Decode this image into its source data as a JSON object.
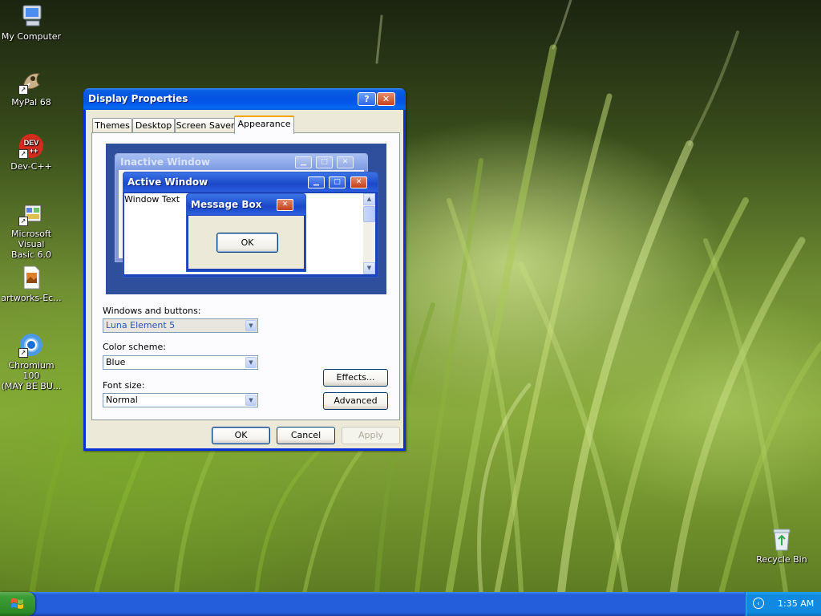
{
  "desktop": {
    "icons": [
      {
        "label": "My Computer",
        "icon": "computer-icon"
      },
      {
        "label": "MyPal 68",
        "icon": "mypal-icon"
      },
      {
        "label": "Dev-C++",
        "icon": "devcpp-icon"
      },
      {
        "label": "Microsoft Visual\nBasic 6.0",
        "icon": "visual-basic-icon"
      },
      {
        "label": "artworks-Ec...",
        "icon": "image-file-icon"
      },
      {
        "label": "Chromium 100\n(MAY BE BU...",
        "icon": "chromium-icon"
      },
      {
        "label": "Recycle Bin",
        "icon": "recycle-bin-icon"
      }
    ],
    "devcpp_badge_top": "DEV",
    "devcpp_badge_bottom": "++"
  },
  "window": {
    "title": "Display Properties",
    "help_label": "?",
    "close_label": "✕",
    "tabs": [
      {
        "label": "Themes"
      },
      {
        "label": "Desktop"
      },
      {
        "label": "Screen Saver"
      },
      {
        "label": "Appearance",
        "active": true
      }
    ],
    "preview": {
      "inactive_title": "Inactive Window",
      "active_title": "Active Window",
      "window_text": "Window Text",
      "message_box_title": "Message Box",
      "message_box_ok": "OK"
    },
    "windows_buttons_label": "Windows and buttons:",
    "windows_buttons_value": "Luna Element 5",
    "color_scheme_label": "Color scheme:",
    "color_scheme_value": "Blue",
    "font_size_label": "Font size:",
    "font_size_value": "Normal",
    "effects_label": "Effects...",
    "advanced_label": "Advanced",
    "ok_label": "OK",
    "cancel_label": "Cancel",
    "apply_label": "Apply"
  },
  "taskbar": {
    "clock": "1:35 AM"
  },
  "colors": {
    "title_blue": "#0a5ee4",
    "face": "#ece9d8",
    "taskbar_blue": "#245edb",
    "start_green": "#3c9d36",
    "tray_blue": "#0f8ae0"
  }
}
